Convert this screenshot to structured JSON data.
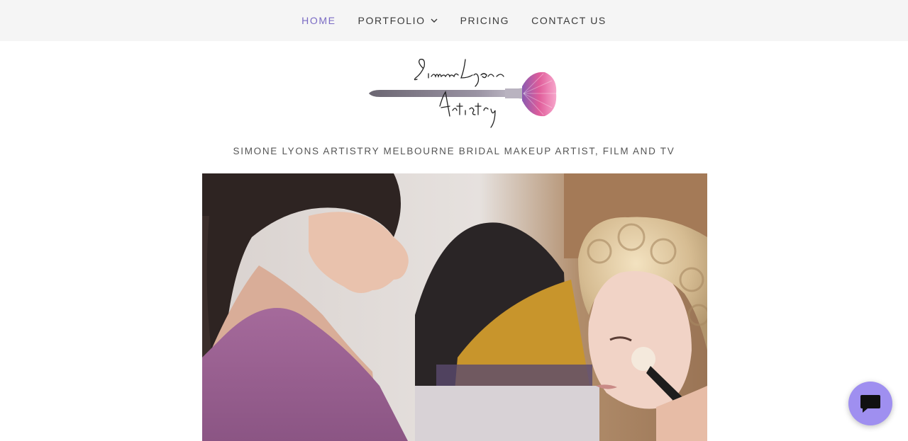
{
  "nav": {
    "items": [
      {
        "label": "HOME",
        "active": true,
        "has_dropdown": false
      },
      {
        "label": "PORTFOLIO",
        "active": false,
        "has_dropdown": true
      },
      {
        "label": "PRICING",
        "active": false,
        "has_dropdown": false
      },
      {
        "label": "CONTACT US",
        "active": false,
        "has_dropdown": false
      }
    ]
  },
  "logo": {
    "line1": "Simone Lyons",
    "line2": "Artistry"
  },
  "tagline": "SIMONE LYONS ARTISTRY MELBOURNE BRIDAL MAKEUP ARTIST, FILM AND TV",
  "colors": {
    "nav_bg": "#f5f5f5",
    "accent": "#7a6bc4",
    "chat_button": "#9f8ff0"
  },
  "icons": {
    "dropdown": "chevron-down-icon",
    "chat": "chat-bubble-icon"
  }
}
